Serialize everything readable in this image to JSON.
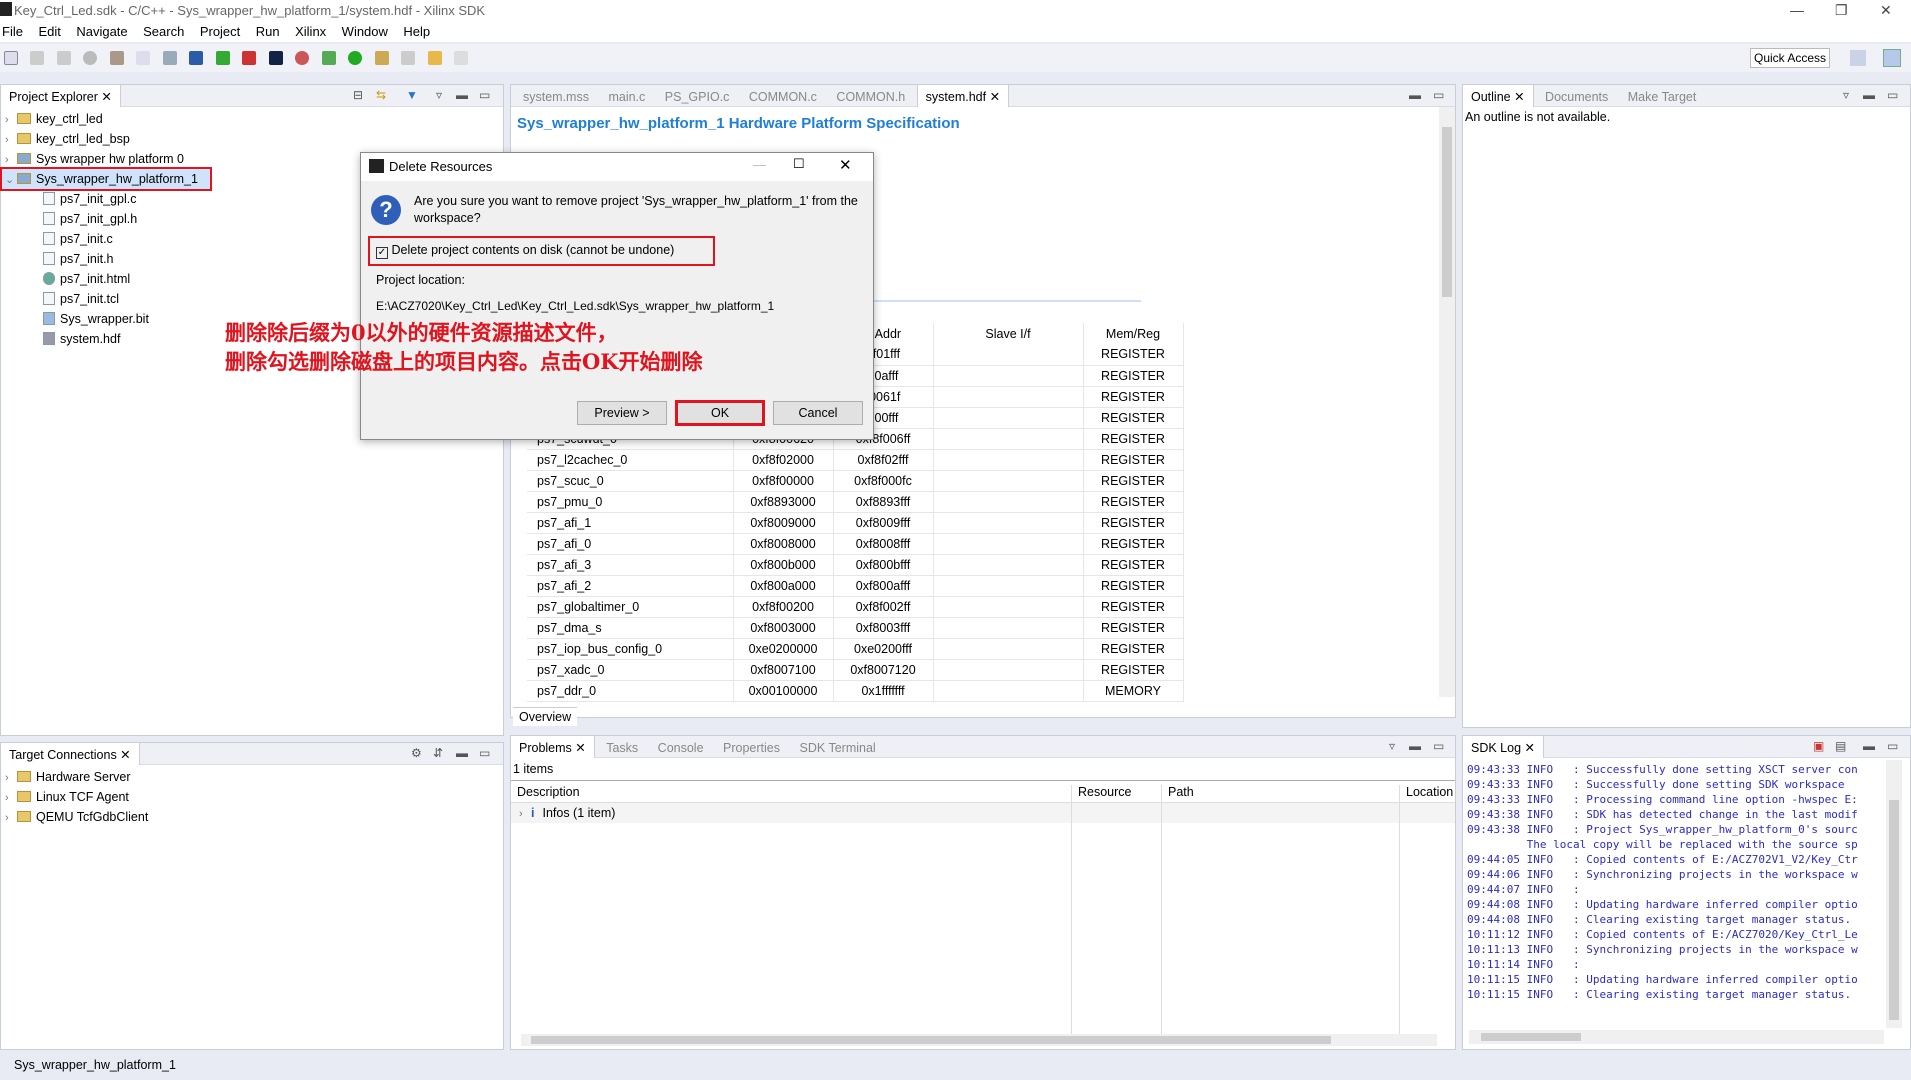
{
  "window": {
    "title": "Key_Ctrl_Led.sdk - C/C++ - Sys_wrapper_hw_platform_1/system.hdf - Xilinx SDK",
    "icon": "SDK"
  },
  "menu": [
    "File",
    "Edit",
    "Navigate",
    "Search",
    "Project",
    "Run",
    "Xilinx",
    "Window",
    "Help"
  ],
  "toolbar": {
    "quick_access": "Quick Access"
  },
  "project_explorer": {
    "tab": "Project Explorer",
    "items": [
      {
        "label": "key_ctrl_led",
        "level": 0,
        "expanded": false
      },
      {
        "label": "key_ctrl_led_bsp",
        "level": 0,
        "expanded": false
      },
      {
        "label": "Sys wrapper hw platform 0",
        "level": 0,
        "expanded": false
      },
      {
        "label": "Sys_wrapper_hw_platform_1",
        "level": 0,
        "expanded": true,
        "selected": true
      },
      {
        "label": "ps7_init_gpl.c",
        "level": 1
      },
      {
        "label": "ps7_init_gpl.h",
        "level": 1
      },
      {
        "label": "ps7_init.c",
        "level": 1
      },
      {
        "label": "ps7_init.h",
        "level": 1
      },
      {
        "label": "ps7_init.html",
        "level": 1
      },
      {
        "label": "ps7_init.tcl",
        "level": 1
      },
      {
        "label": "Sys_wrapper.bit",
        "level": 1
      },
      {
        "label": "system.hdf",
        "level": 1
      }
    ]
  },
  "editor": {
    "tabs": [
      "system.mss",
      "main.c",
      "PS_GPIO.c",
      "COMMON.c",
      "COMMON.h",
      "system.hdf"
    ],
    "active_tab": "system.hdf",
    "heading": "Sys_wrapper_hw_platform_1 Hardware Platform Specification",
    "columns": [
      "",
      "",
      "n Addr",
      "Slave I/f",
      "Mem/Reg"
    ],
    "rows": [
      [
        "",
        "",
        "8f01fff",
        "",
        "REGISTER"
      ],
      [
        "",
        "",
        "00afff",
        "",
        "REGISTER"
      ],
      [
        "",
        "",
        "f0061f",
        "",
        "REGISTER"
      ],
      [
        "",
        "",
        "000fff",
        "",
        "REGISTER"
      ],
      [
        "ps7_scuwdt_0",
        "0xf8f00620",
        "0xf8f006ff",
        "",
        "REGISTER"
      ],
      [
        "ps7_l2cachec_0",
        "0xf8f02000",
        "0xf8f02fff",
        "",
        "REGISTER"
      ],
      [
        "ps7_scuc_0",
        "0xf8f00000",
        "0xf8f000fc",
        "",
        "REGISTER"
      ],
      [
        "ps7_pmu_0",
        "0xf8893000",
        "0xf8893fff",
        "",
        "REGISTER"
      ],
      [
        "ps7_afi_1",
        "0xf8009000",
        "0xf8009fff",
        "",
        "REGISTER"
      ],
      [
        "ps7_afi_0",
        "0xf8008000",
        "0xf8008fff",
        "",
        "REGISTER"
      ],
      [
        "ps7_afi_3",
        "0xf800b000",
        "0xf800bfff",
        "",
        "REGISTER"
      ],
      [
        "ps7_afi_2",
        "0xf800a000",
        "0xf800afff",
        "",
        "REGISTER"
      ],
      [
        "ps7_globaltimer_0",
        "0xf8f00200",
        "0xf8f002ff",
        "",
        "REGISTER"
      ],
      [
        "ps7_dma_s",
        "0xf8003000",
        "0xf8003fff",
        "",
        "REGISTER"
      ],
      [
        "ps7_iop_bus_config_0",
        "0xe0200000",
        "0xe0200fff",
        "",
        "REGISTER"
      ],
      [
        "ps7_xadc_0",
        "0xf8007100",
        "0xf8007120",
        "",
        "REGISTER"
      ],
      [
        "ps7_ddr_0",
        "0x00100000",
        "0x1fffffff",
        "",
        "MEMORY"
      ]
    ],
    "bottom_tab": "Overview"
  },
  "outline": {
    "tabs": [
      "Outline",
      "Documents",
      "Make Target"
    ],
    "message": "An outline is not available."
  },
  "target_connections": {
    "tab": "Target Connections",
    "items": [
      "Hardware Server",
      "Linux TCF Agent",
      "QEMU TcfGdbClient"
    ]
  },
  "problems": {
    "tabs": [
      "Problems",
      "Tasks",
      "Console",
      "Properties",
      "SDK Terminal"
    ],
    "count": "1 items",
    "columns": [
      "Description",
      "Resource",
      "Path",
      "Location"
    ],
    "rows": [
      "Infos (1 item)"
    ]
  },
  "sdk_log": {
    "tab": "SDK Log",
    "lines": [
      "09:43:33 INFO   : Successfully done setting XSCT server con",
      "09:43:33 INFO   : Successfully done setting SDK workspace",
      "09:43:33 INFO   : Processing command line option -hwspec E:",
      "09:43:38 INFO   : SDK has detected change in the last modif",
      "09:43:38 INFO   : Project Sys_wrapper_hw_platform_0's sourc",
      "         The local copy will be replaced with the source sp",
      "09:44:05 INFO   : Copied contents of E:/ACZ702V1_V2/Key_Ctr",
      "09:44:06 INFO   : Synchronizing projects in the workspace w",
      "09:44:07 INFO   :",
      "09:44:08 INFO   : Updating hardware inferred compiler optio",
      "09:44:08 INFO   : Clearing existing target manager status.",
      "10:11:12 INFO   : Copied contents of E:/ACZ7020/Key_Ctrl_Le",
      "10:11:13 INFO   : Synchronizing projects in the workspace w",
      "10:11:14 INFO   :",
      "10:11:15 INFO   : Updating hardware inferred compiler optio",
      "10:11:15 INFO   : Clearing existing target manager status."
    ]
  },
  "dialog": {
    "title": "Delete Resources",
    "message": "Are you sure you want to remove project 'Sys_wrapper_hw_platform_1' from the workspace?",
    "checkbox_label": "Delete project contents on disk (cannot be undone)",
    "checkbox_checked": true,
    "location_label": "Project location:",
    "location": "E:\\ACZ7020\\Key_Ctrl_Led\\Key_Ctrl_Led.sdk\\Sys_wrapper_hw_platform_1",
    "preview": "Preview >",
    "ok": "OK",
    "cancel": "Cancel"
  },
  "annotation": {
    "line1": "删除除后缀为0以外的硬件资源描述文件，",
    "line2": "删除勾选删除磁盘上的项目内容。点击OK开始删除"
  },
  "status_bar": {
    "text": "Sys_wrapper_hw_platform_1"
  },
  "colors": {
    "highlight": "#e0141e",
    "heading": "#1e7fd6",
    "log": "#2b2bc8"
  }
}
